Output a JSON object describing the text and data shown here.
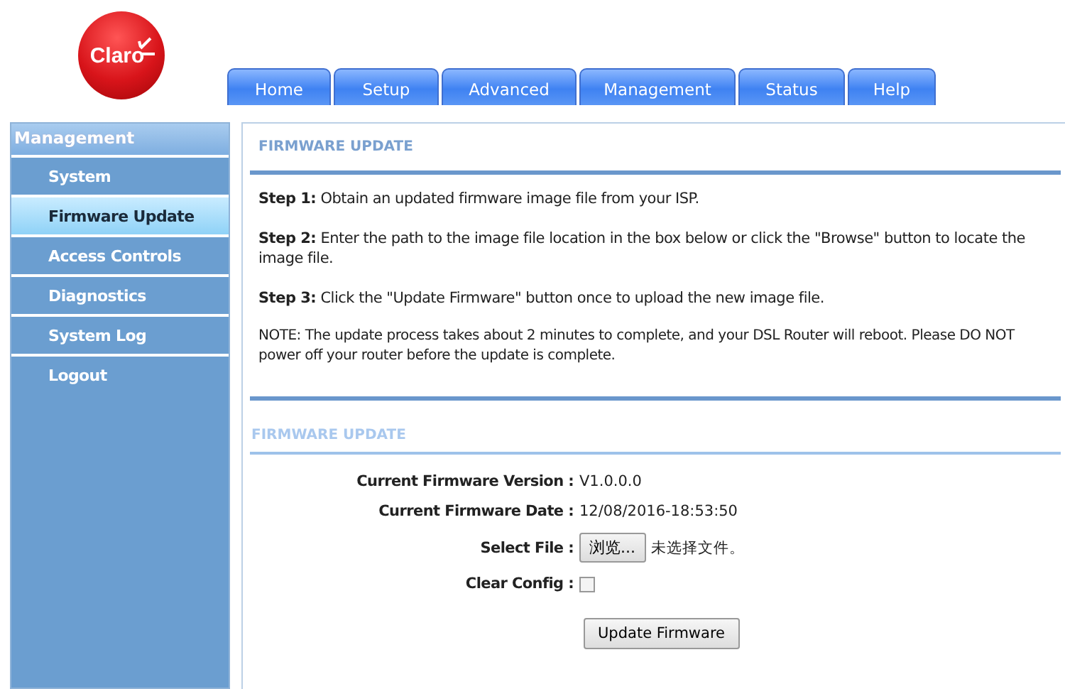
{
  "logo": {
    "text": "Claro"
  },
  "tabs": [
    {
      "label": "Home",
      "selected": false
    },
    {
      "label": "Setup",
      "selected": false
    },
    {
      "label": "Advanced",
      "selected": false
    },
    {
      "label": "Management",
      "selected": false
    },
    {
      "label": "Status",
      "selected": false
    },
    {
      "label": "Help",
      "selected": false
    }
  ],
  "sidebar": {
    "title": "Management",
    "items": [
      {
        "label": "System",
        "selected": false
      },
      {
        "label": "Firmware Update",
        "selected": true
      },
      {
        "label": "Access Controls",
        "selected": false
      },
      {
        "label": "Diagnostics",
        "selected": false
      },
      {
        "label": "System Log",
        "selected": false
      },
      {
        "label": "Logout",
        "selected": false
      }
    ]
  },
  "intro": {
    "title": "FIRMWARE UPDATE",
    "paragraphs": [
      "**Step 1:** Obtain an updated firmware image file from your ISP.",
      "**Step 2:** Enter the path to the image file location in the box below or click the \"Browse\" button to locate the image file.",
      "**Step 3:** Click the \"Update Firmware\" button once to upload the new image file.",
      "NOTE: The update process takes about 2 minutes to complete, and your DSL Router will reboot. Please DO NOT power off your router before the update is complete."
    ]
  },
  "form": {
    "title": "FIRMWARE UPDATE",
    "fields": [
      {
        "kind": "text",
        "label": "Current Firmware Version :",
        "value": "V1.0.0.0"
      },
      {
        "kind": "text",
        "label": "Current Firmware Date :",
        "value": "12/08/2016-18:53:50"
      },
      {
        "kind": "file",
        "label": "Select File :",
        "button": "浏览...",
        "value": "未选择文件。"
      },
      {
        "kind": "checkbox",
        "label": "Clear Config :",
        "checked": false
      }
    ],
    "submit": "Update Firmware"
  }
}
